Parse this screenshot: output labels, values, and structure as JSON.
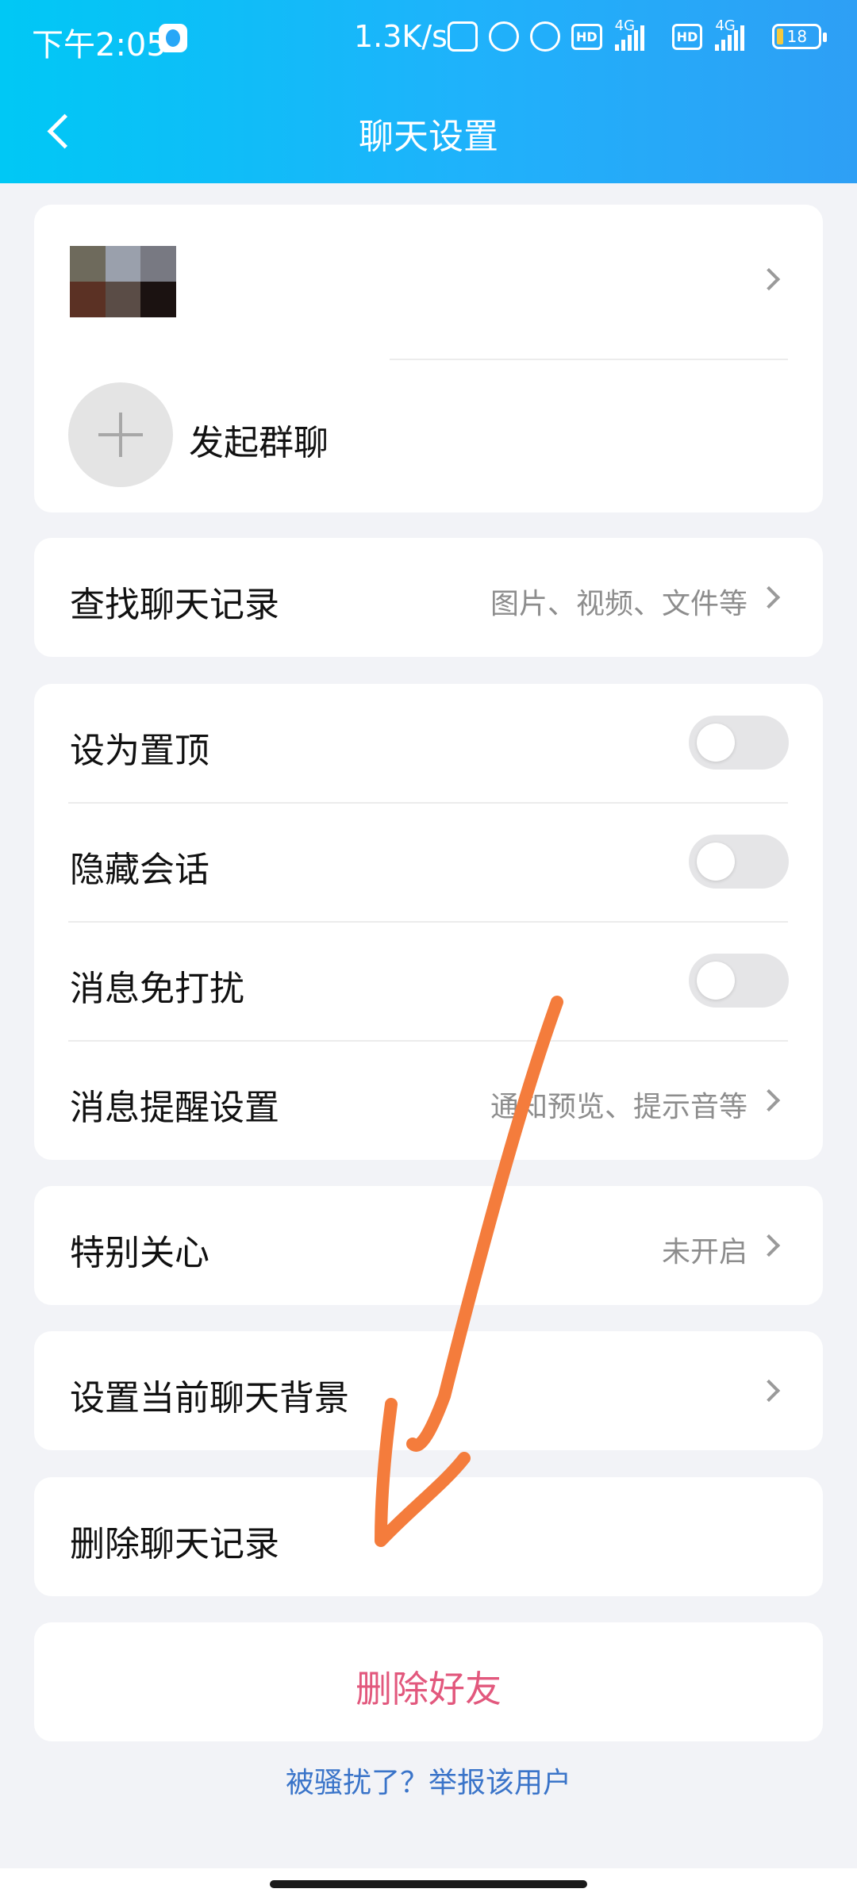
{
  "status_bar": {
    "time": "下午2:05",
    "speed": "1.3K/s",
    "hd_label": "HD",
    "net_label": "4G",
    "battery": "18"
  },
  "header": {
    "title": "聊天设置"
  },
  "profile_card": {
    "start_group_label": "发起群聊",
    "avatar_colors": [
      "#6e6a5c",
      "#9aa0ac",
      "#787982",
      "#5b3124",
      "#5a4c46",
      "#1b1211"
    ]
  },
  "search_history": {
    "label": "查找聊天记录",
    "hint": "图片、视频、文件等"
  },
  "toggles": [
    {
      "label": "设为置顶",
      "on": false
    },
    {
      "label": "隐藏会话",
      "on": false
    },
    {
      "label": "消息免打扰",
      "on": false
    }
  ],
  "notify_settings": {
    "label": "消息提醒设置",
    "hint": "通知预览、提示音等"
  },
  "special_care": {
    "label": "特别关心",
    "hint": "未开启"
  },
  "chat_background": {
    "label": "设置当前聊天背景"
  },
  "delete_history": {
    "label": "删除聊天记录"
  },
  "delete_friend": {
    "label": "删除好友",
    "color": "#e2587d"
  },
  "report": {
    "label": "被骚扰了？举报该用户"
  },
  "annotation": {
    "color": "#f47c3c",
    "icon": "hand-drawn-arrow"
  }
}
